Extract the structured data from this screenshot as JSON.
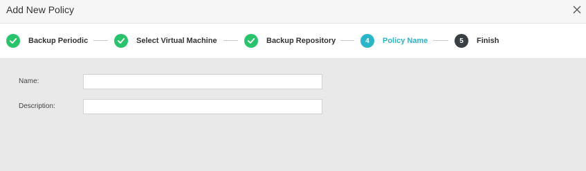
{
  "dialog": {
    "title": "Add New Policy",
    "close_icon": "close-icon"
  },
  "steps": [
    {
      "label": "Backup Periodic",
      "state": "done",
      "marker": ""
    },
    {
      "label": "Select Virtual Machine",
      "state": "done",
      "marker": ""
    },
    {
      "label": "Backup Repository",
      "state": "done",
      "marker": ""
    },
    {
      "label": "Policy Name",
      "state": "active",
      "marker": "4"
    },
    {
      "label": "Finish",
      "state": "pending",
      "marker": "5"
    }
  ],
  "form": {
    "name_label": "Name:",
    "name_value": "",
    "description_label": "Description:",
    "description_value": ""
  },
  "colors": {
    "done": "#27c46b",
    "active": "#29b6c9",
    "pending": "#3a3f44",
    "body_bg": "#e9e9e9"
  }
}
